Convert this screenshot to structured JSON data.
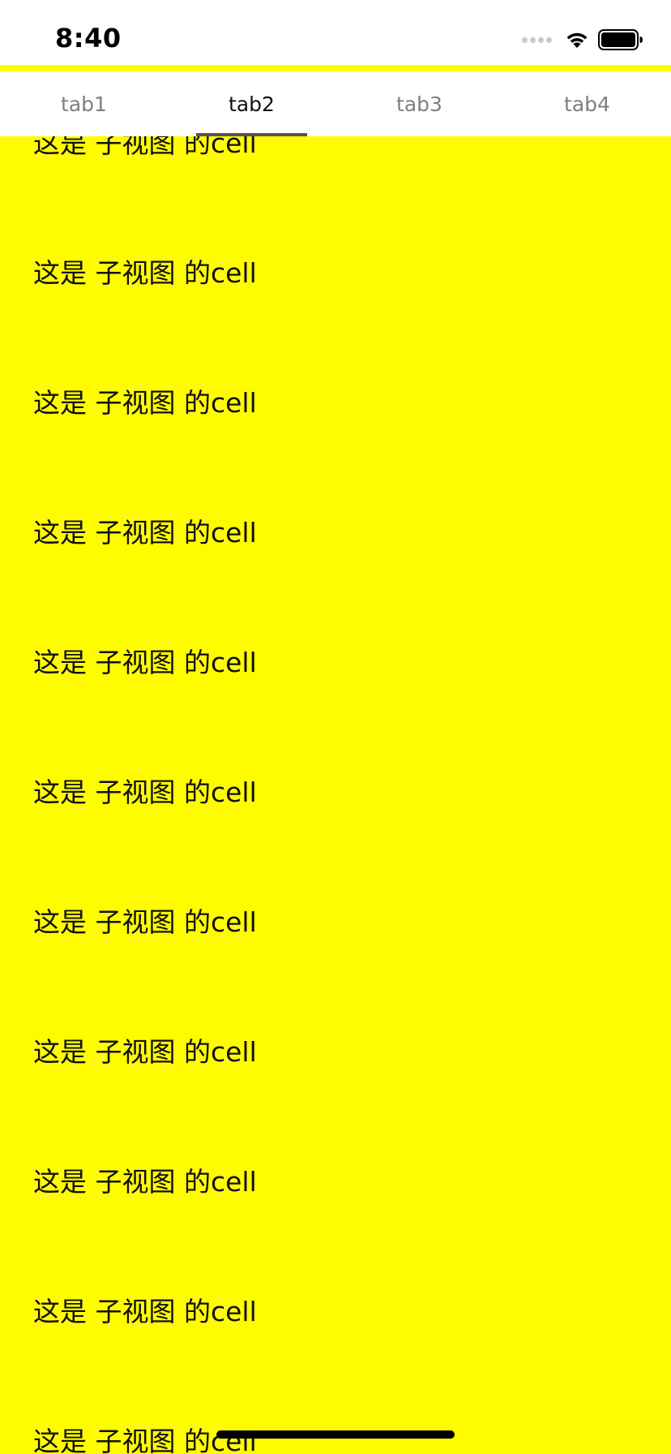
{
  "status_bar": {
    "time": "8:40"
  },
  "tabs": [
    {
      "label": "tab1",
      "active": false
    },
    {
      "label": "tab2",
      "active": true
    },
    {
      "label": "tab3",
      "active": false
    },
    {
      "label": "tab4",
      "active": false
    }
  ],
  "list": {
    "cells": [
      {
        "label": "这是 子视图 的cell"
      },
      {
        "label": "这是 子视图 的cell"
      },
      {
        "label": "这是 子视图 的cell"
      },
      {
        "label": "这是 子视图 的cell"
      },
      {
        "label": "这是 子视图 的cell"
      },
      {
        "label": "这是 子视图 的cell"
      },
      {
        "label": "这是 子视图 的cell"
      },
      {
        "label": "这是 子视图 的cell"
      },
      {
        "label": "这是 子视图 的cell"
      },
      {
        "label": "这是 子视图 的cell"
      },
      {
        "label": "这是 子视图 的cell"
      }
    ]
  },
  "colors": {
    "background": "#FFFC00",
    "tab_bar": "#FFFFFF",
    "tab_active": "#111111",
    "tab_inactive": "#7F7F7F",
    "indicator": "#555555"
  },
  "icons": {
    "signal": "signal-dots-icon",
    "wifi": "wifi-icon",
    "battery": "battery-icon"
  }
}
